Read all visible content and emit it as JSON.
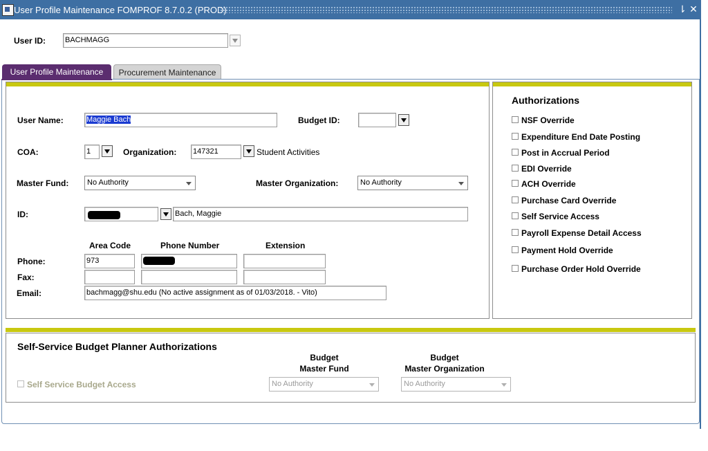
{
  "window": {
    "title": "User Profile Maintenance  FOMPROF  8.7.0.2  (PROD)",
    "minimize_glyph": "⇂",
    "close_glyph": "✕"
  },
  "key_block": {
    "user_id_label": "User ID:",
    "user_id_value": "BACHMAGG"
  },
  "tabs": [
    {
      "label": "User Profile Maintenance",
      "active": true
    },
    {
      "label": "Procurement Maintenance",
      "active": false
    }
  ],
  "profile": {
    "user_name_label": "User Name:",
    "user_name_value": "Maggie Bach",
    "budget_id_label": "Budget ID:",
    "budget_id_value": "",
    "coa_label": "COA:",
    "coa_value": "1",
    "organization_label": "Organization:",
    "organization_value": "147321",
    "organization_desc": "Student Activities",
    "master_fund_label": "Master Fund:",
    "master_fund_value": "No Authority",
    "master_org_label": "Master Organization:",
    "master_org_value": "No Authority",
    "id_label": "ID:",
    "id_value": "",
    "id_name": "Bach, Maggie",
    "area_code_header": "Area Code",
    "phone_number_header": "Phone Number",
    "extension_header": "Extension",
    "phone_label": "Phone:",
    "phone_area": "973",
    "phone_number": "",
    "phone_ext": "",
    "fax_label": "Fax:",
    "fax_area": "",
    "fax_number": "",
    "fax_ext": "",
    "email_label": "Email:",
    "email_value": "bachmagg@shu.edu (No active assignment as of 01/03/2018. - Vito)"
  },
  "authorizations": {
    "title": "Authorizations",
    "items": [
      {
        "label": "NSF Override",
        "checked": false
      },
      {
        "label": "Expenditure End Date Posting",
        "checked": false
      },
      {
        "label": "Post in Accrual Period",
        "checked": false
      },
      {
        "label": "EDI Override",
        "checked": false
      },
      {
        "label": "ACH Override",
        "checked": false
      },
      {
        "label": "Purchase Card Override",
        "checked": false
      },
      {
        "label": "Self Service Access",
        "checked": false
      },
      {
        "label": "Payroll Expense Detail Access",
        "checked": false
      },
      {
        "label": "Payment Hold Override",
        "checked": false
      },
      {
        "label": "Purchase Order Hold Override",
        "checked": false
      }
    ]
  },
  "budget_planner": {
    "title": "Self-Service Budget Planner Authorizations",
    "fund_header_line1": "Budget",
    "fund_header_line2": "Master Fund",
    "org_header_line1": "Budget",
    "org_header_line2": "Master Organization",
    "access_label": "Self Service Budget Access",
    "access_checked": false,
    "fund_value": "No Authority",
    "org_value": "No Authority"
  },
  "colors": {
    "titlebar": "#3e6fa3",
    "active_tab": "#5b2d6f",
    "inactive_tab": "#d4d4d4",
    "section_bar": "#c8c810",
    "selection": "#1b3bd1"
  }
}
